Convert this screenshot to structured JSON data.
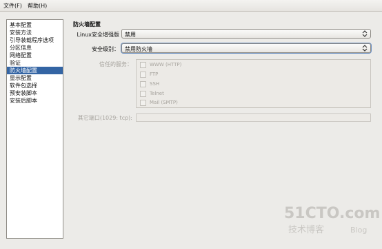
{
  "menubar": {
    "file_label": "文件(F)",
    "help_label": "帮助(H)"
  },
  "sidebar": {
    "items": [
      {
        "label": "基本配置"
      },
      {
        "label": "安装方法"
      },
      {
        "label": "引导装载程序选项"
      },
      {
        "label": "分区信息"
      },
      {
        "label": "网络配置"
      },
      {
        "label": "验证"
      },
      {
        "label": "防火墙配置",
        "selected": true
      },
      {
        "label": "显示配置"
      },
      {
        "label": "软件包选择"
      },
      {
        "label": "预安装脚本"
      },
      {
        "label": "安装后脚本"
      }
    ]
  },
  "firewall": {
    "title": "防火墙配置",
    "selinux_label": "Linux安全增强版",
    "selinux_value": "禁用",
    "security_level_label": "安全级别：",
    "security_level_value": "禁用防火墙",
    "trusted_services_label": "信任的服务：",
    "services": [
      {
        "label": "WWW (HTTP)",
        "checked": false
      },
      {
        "label": "FTP",
        "checked": false
      },
      {
        "label": "SSH",
        "checked": false
      },
      {
        "label": "Telnet",
        "checked": false
      },
      {
        "label": "Mail (SMTP)",
        "checked": false
      }
    ],
    "other_ports_label": "其它端口(1029: tcp):",
    "other_ports_value": ""
  },
  "watermark": {
    "brand": "51CTO.com",
    "sub": "技术博客",
    "blog": "Blog"
  },
  "colors": {
    "selection": "#3465a4",
    "window_bg": "#ecebe8"
  }
}
